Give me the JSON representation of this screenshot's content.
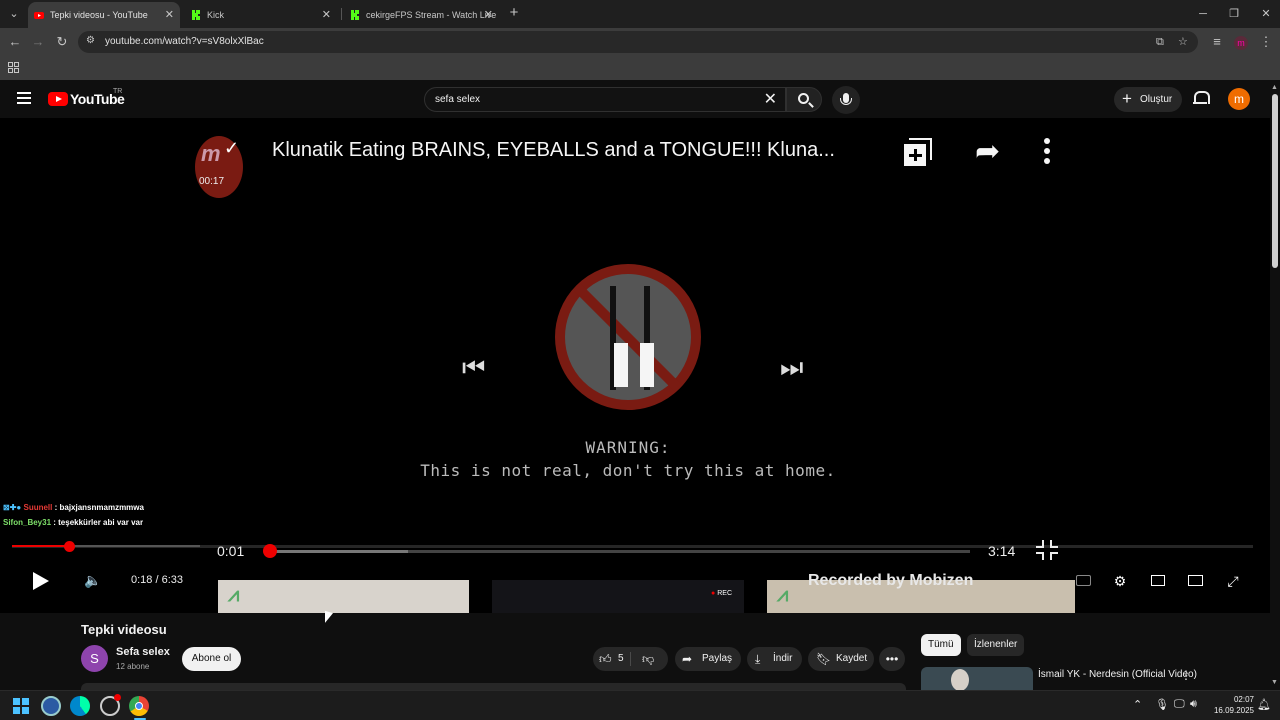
{
  "browser": {
    "tabs": [
      {
        "title": "Tepki videosu - YouTube",
        "active": true,
        "favicon": "youtube-favicon"
      },
      {
        "title": "Kick",
        "active": false,
        "favicon": "kick-favicon"
      },
      {
        "title": "cekirgeFPS Stream - Watch Live",
        "active": false,
        "favicon": "kick-favicon"
      }
    ],
    "url": "youtube.com/watch?v=sV8olxXlBac",
    "profile_initial": "m"
  },
  "youtube": {
    "logo_text": "YouTube",
    "country_code": "TR",
    "search_value": "sefa selex",
    "create_label": "Oluştur",
    "avatar_initial": "m"
  },
  "player": {
    "embed": {
      "title": "Klunatik Eating BRAINS, EYEBALLS and a TONGUE!!!  Kluna...",
      "avatar_time": "00:17",
      "warning_line1": "WARNING:",
      "warning_line2": "This is not real, don't try this at home.",
      "inner_time_current": "0:01",
      "inner_time_total": "3:14",
      "inner_progress_fraction": 0.3,
      "thumb_rec_label": "REC",
      "recorded_by": "Recorded by Mobizen"
    },
    "chat": [
      {
        "user": "Suunell",
        "message": "bajxjansnmamzmmwa"
      },
      {
        "user": "Sifon_Bey31",
        "message": "teşekkürler abi var var"
      }
    ],
    "time_current": "0:18",
    "time_separator": " / ",
    "time_total": "6:33",
    "progress_fraction": 0.046
  },
  "video": {
    "title": "Tepki videosu",
    "channel_name": "Sefa selex",
    "channel_initial": "S",
    "subscribers": "12 abone",
    "subscribe_label": "Abone ol",
    "like_count": "5",
    "share_label": "Paylaş",
    "download_label": "İndir",
    "save_label": "Kaydet"
  },
  "sidebar": {
    "chips": [
      "Tümü",
      "İzlenenler"
    ],
    "related": [
      {
        "title": "İsmail YK - Nerdesin (Official Video)"
      }
    ]
  },
  "taskbar": {
    "time": "02:07",
    "date": "16.09.2025"
  },
  "colors": {
    "youtube_red": "#ff0000",
    "progress_red": "#e00000",
    "kick_green": "#53fc18",
    "avatar_orange": "#ef6c00",
    "channel_purple": "#8e44ad"
  }
}
